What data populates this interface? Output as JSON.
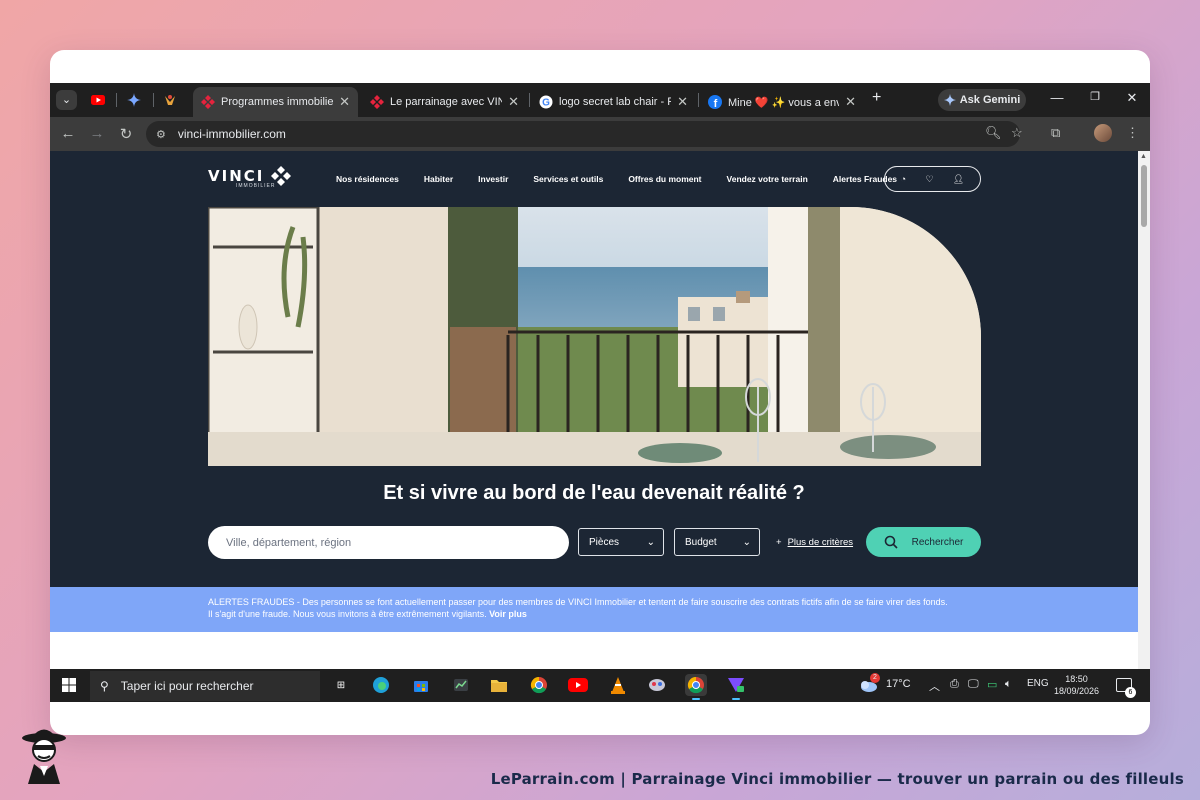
{
  "browser": {
    "tabs": [
      {
        "title": "",
        "favicon": "youtube-icon",
        "pinned": true
      },
      {
        "title": "",
        "favicon": "gemini-icon",
        "pinned": true
      },
      {
        "title": "",
        "favicon": "bird-icon",
        "pinned": true
      },
      {
        "title": "Programmes immobiliers d",
        "favicon": "vinci-icon",
        "active": true
      },
      {
        "title": "Le parrainage avec VINCI I",
        "favicon": "vinci-icon"
      },
      {
        "title": "logo secret lab chair - Rech",
        "favicon": "google-icon"
      },
      {
        "title": "Mine ❤️ ✨ vous a envoyé",
        "favicon": "facebook-icon"
      }
    ],
    "gemini_label": "Ask Gemini",
    "url": "vinci-immobilier.com"
  },
  "site": {
    "logo_text": "VINCI",
    "logo_sub": "IMMOBILIER",
    "nav": [
      "Nos résidences",
      "Habiter",
      "Investir",
      "Services et outils",
      "Offres du moment",
      "Vendez votre terrain",
      "Alertes Fraudes"
    ],
    "hero_title": "Et si vivre au bord de l'eau devenait réalité ?",
    "search": {
      "placeholder": "Ville, département, région",
      "pieces_label": "Pièces",
      "budget_label": "Budget",
      "more_criteria": "Plus de critères",
      "button_label": "Rechercher"
    },
    "alert": {
      "line1": "ALERTES FRAUDES - Des personnes se font actuellement passer pour des membres de VINCI Immobilier et tentent de faire souscrire des contrats fictifs afin de se faire virer des fonds.",
      "line2": "Il s'agit d'une fraude. Nous vous invitons à être extrêmement vigilants.",
      "link": "Voir plus"
    }
  },
  "taskbar": {
    "search_placeholder": "Taper ici pour rechercher",
    "weather_badge": "2",
    "temperature": "17°C",
    "language": "ENG",
    "time": "18:50",
    "date": "18/09/2026",
    "notification_count": "6"
  },
  "caption": "LeParrain.com | Parrainage Vinci immobilier — trouver un parrain ou des filleuls",
  "colors": {
    "page_bg": "#1c2634",
    "accent_button": "#4fd1b4",
    "alert_bg": "#7fa6f8"
  }
}
